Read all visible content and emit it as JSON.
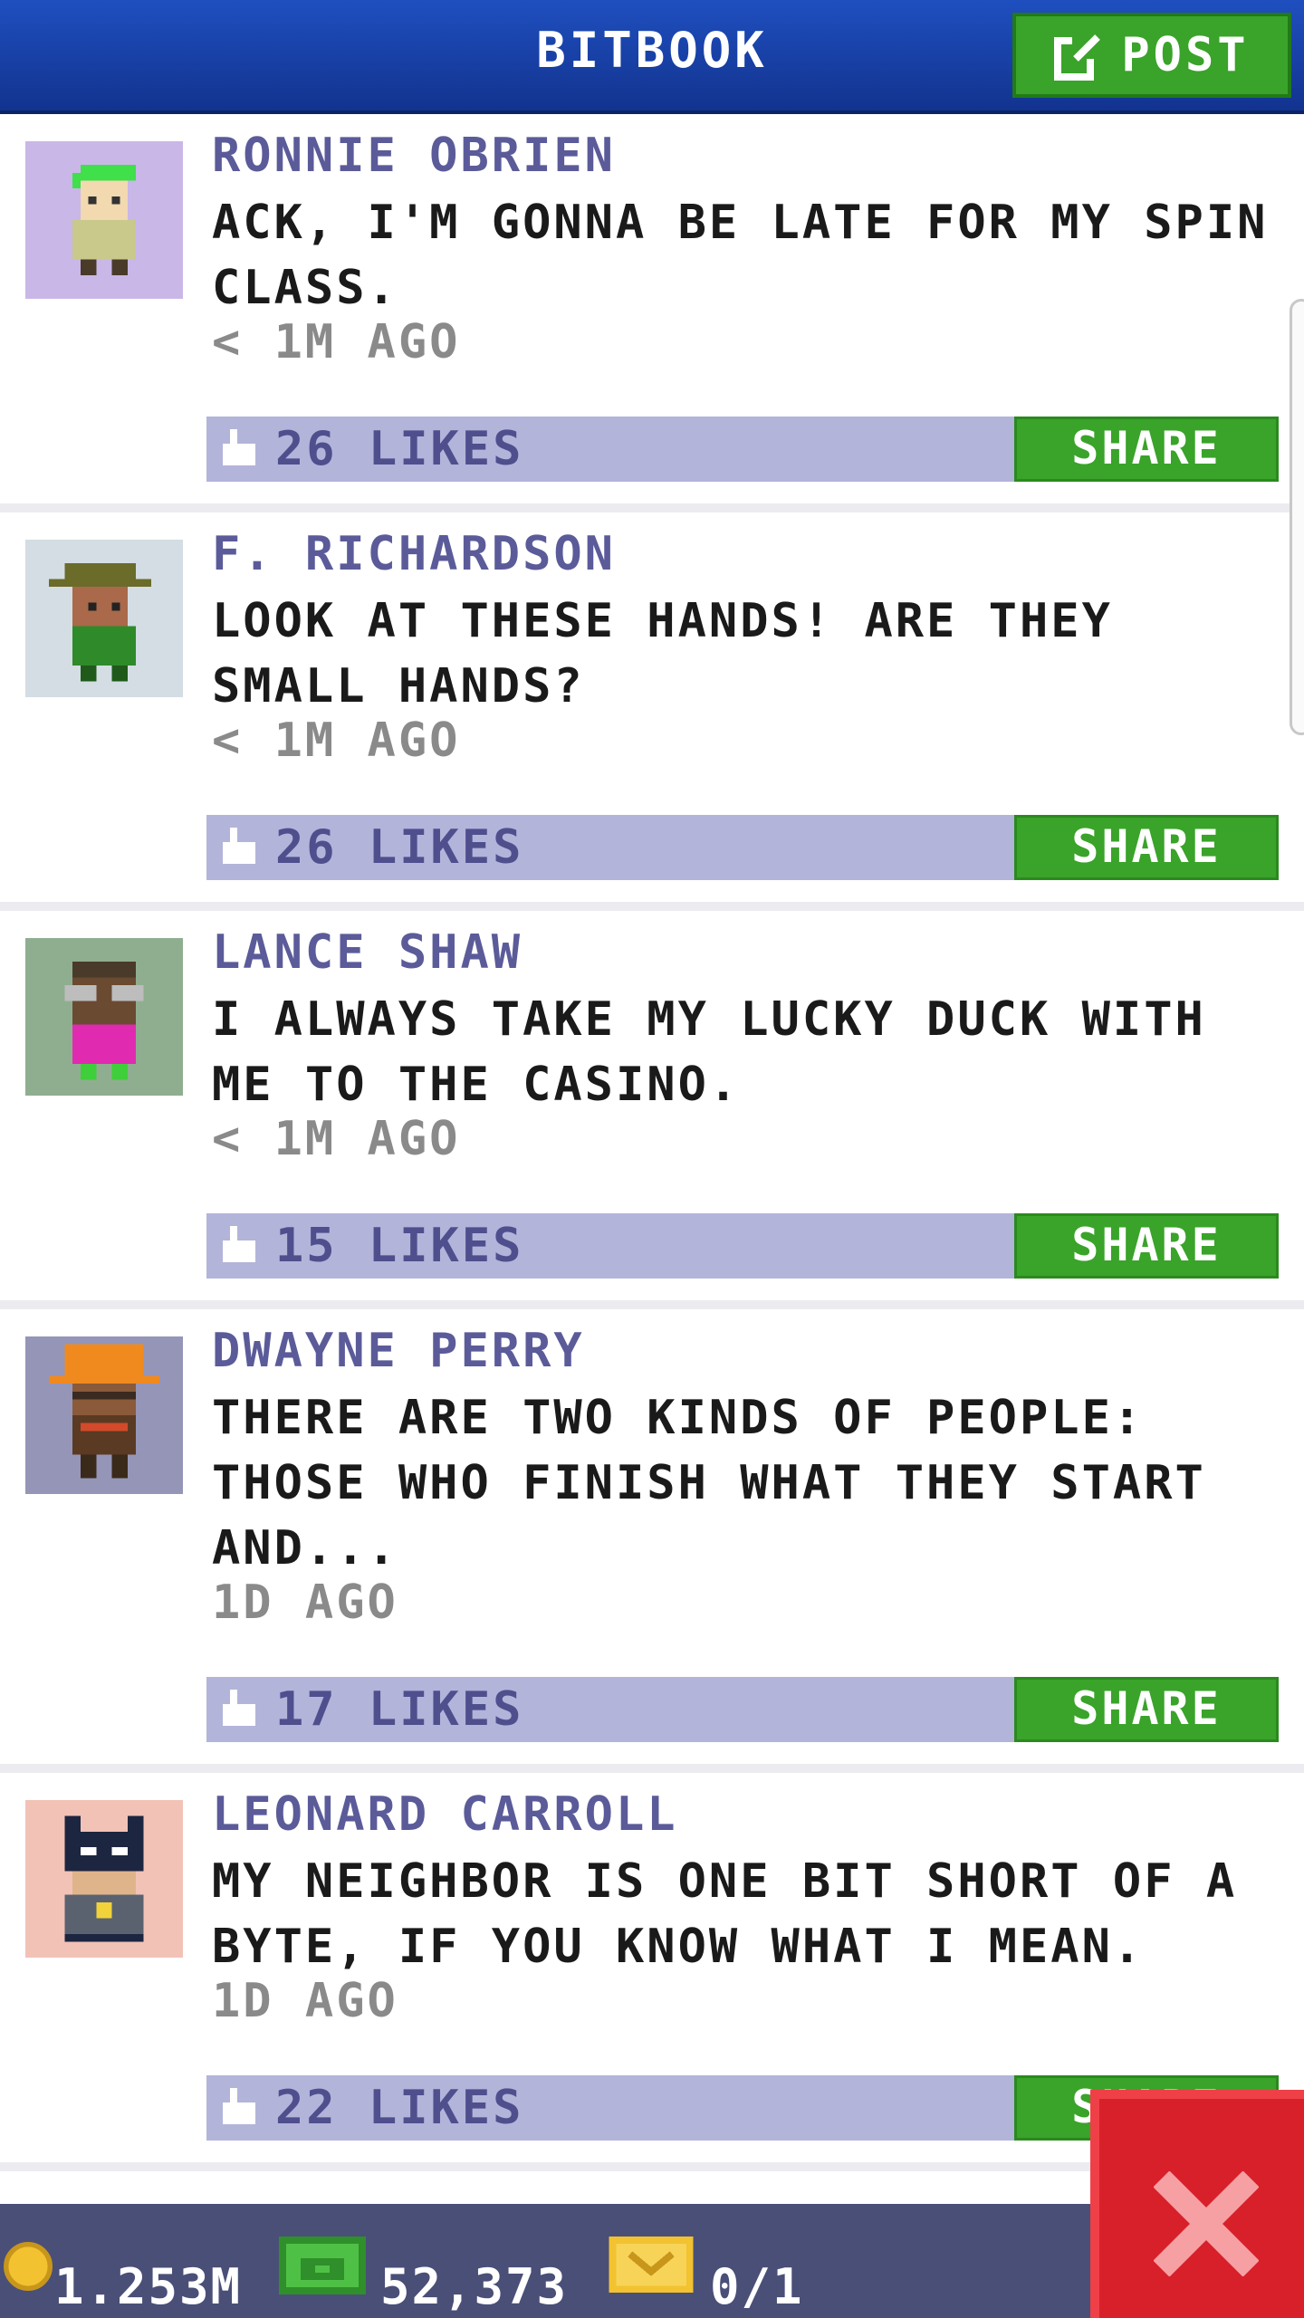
{
  "header": {
    "title": "BITBOOK",
    "post_label": "POST"
  },
  "posts": [
    {
      "name": "RONNIE OBRIEN",
      "message": "ACK, I'M GONNA BE LATE FOR MY SPIN CLASS.",
      "time": "< 1M AGO",
      "likes": "26 LIKES",
      "share_label": "SHARE"
    },
    {
      "name": "F. RICHARDSON",
      "message": "LOOK AT THESE HANDS! ARE THEY SMALL HANDS?",
      "time": "< 1M AGO",
      "likes": "26 LIKES",
      "share_label": "SHARE"
    },
    {
      "name": "LANCE SHAW",
      "message": "I ALWAYS TAKE MY LUCKY DUCK WITH ME TO THE CASINO.",
      "time": "< 1M AGO",
      "likes": "15 LIKES",
      "share_label": "SHARE"
    },
    {
      "name": "DWAYNE PERRY",
      "message": "THERE ARE TWO KINDS OF PEOPLE: THOSE WHO FINISH WHAT THEY START AND...",
      "time": "1D AGO",
      "likes": "17 LIKES",
      "share_label": "SHARE"
    },
    {
      "name": "LEONARD CARROLL",
      "message": "MY NEIGHBOR IS ONE BIT SHORT OF A BYTE, IF YOU KNOW WHAT I MEAN.",
      "time": "1D AGO",
      "likes": "22 LIKES",
      "share_label": "SHARE"
    }
  ],
  "footer": {
    "coins": "1.253M",
    "bux": "52,373",
    "tickets": "0/1"
  },
  "icons": {
    "post": "edit-icon",
    "like": "thumbs-up-icon",
    "coin": "coin-icon",
    "bux": "bux-icon",
    "ticket": "ticket-icon",
    "close": "close-icon"
  },
  "colors": {
    "header": "#1f4fbf",
    "accent_green": "#3aa32a",
    "likes_bar": "#b3b4da",
    "name_text": "#5b5b9a",
    "footer": "#4a4f78",
    "close": "#d8202a"
  }
}
